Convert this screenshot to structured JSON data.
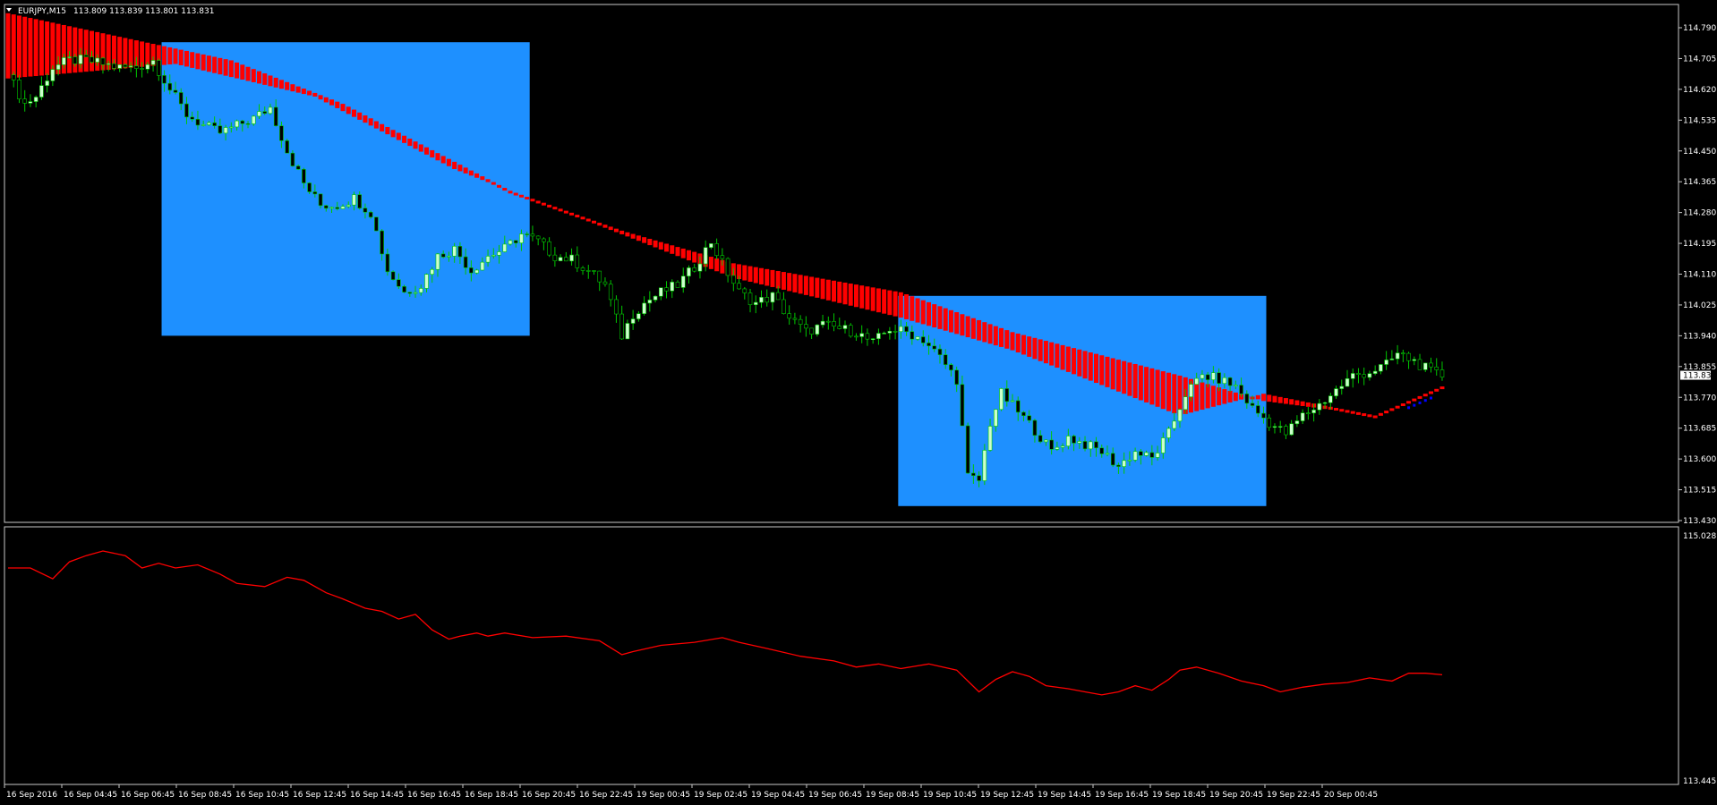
{
  "window": {
    "symbol": "EURJPY,M15",
    "ohlc": "113.809 113.839 113.801 113.831"
  },
  "colors": {
    "background": "#000000",
    "highlight": "#1e90ff",
    "band": "#ff0000",
    "bull_body": "#ccffcc",
    "bear_body": "#000000",
    "wick": "#00c800",
    "indicator": "#ff0000",
    "cursor_dots": "#0000ff"
  },
  "chart_data": [
    {
      "type": "candlestick",
      "title": "EURJPY,M15",
      "y_ticks": [
        "114.790",
        "114.705",
        "114.620",
        "114.535",
        "114.450",
        "114.365",
        "114.280",
        "114.195",
        "114.110",
        "114.025",
        "113.940",
        "113.855",
        "113.770",
        "113.685",
        "113.600",
        "113.515",
        "113.430"
      ],
      "ylim": [
        113.43,
        114.79
      ],
      "x_ticks": [
        "16 Sep 2016",
        "16 Sep 04:45",
        "16 Sep 06:45",
        "16 Sep 08:45",
        "16 Sep 10:45",
        "16 Sep 12:45",
        "16 Sep 14:45",
        "16 Sep 16:45",
        "16 Sep 18:45",
        "16 Sep 20:45",
        "16 Sep 22:45",
        "19 Sep 00:45",
        "19 Sep 02:45",
        "19 Sep 04:45",
        "19 Sep 06:45",
        "19 Sep 08:45",
        "19 Sep 10:45",
        "19 Sep 12:45",
        "19 Sep 14:45",
        "19 Sep 16:45",
        "19 Sep 18:45",
        "19 Sep 20:45",
        "19 Sep 22:45",
        "20 Sep 00:45"
      ],
      "current_price": "113.831",
      "close_path": [
        [
          0,
          114.66
        ],
        [
          3,
          114.58
        ],
        [
          5,
          114.6
        ],
        [
          8,
          114.68
        ],
        [
          11,
          114.7
        ],
        [
          14,
          114.7
        ],
        [
          17,
          114.69
        ],
        [
          20,
          114.68
        ],
        [
          23,
          114.68
        ],
        [
          26,
          114.7
        ],
        [
          29,
          114.62
        ],
        [
          32,
          114.55
        ],
        [
          35,
          114.52
        ],
        [
          38,
          114.5
        ],
        [
          41,
          114.52
        ],
        [
          44,
          114.54
        ],
        [
          47,
          114.57
        ],
        [
          50,
          114.45
        ],
        [
          53,
          114.36
        ],
        [
          56,
          114.3
        ],
        [
          59,
          114.3
        ],
        [
          62,
          114.32
        ],
        [
          65,
          114.28
        ],
        [
          68,
          114.12
        ],
        [
          71,
          114.06
        ],
        [
          74,
          114.08
        ],
        [
          77,
          114.16
        ],
        [
          80,
          114.18
        ],
        [
          83,
          114.12
        ],
        [
          86,
          114.16
        ],
        [
          89,
          114.18
        ],
        [
          92,
          114.22
        ],
        [
          95,
          114.2
        ],
        [
          98,
          114.16
        ],
        [
          101,
          114.15
        ],
        [
          104,
          114.12
        ],
        [
          107,
          114.08
        ],
        [
          110,
          113.94
        ],
        [
          112,
          114.0
        ],
        [
          114,
          114.03
        ],
        [
          117,
          114.06
        ],
        [
          120,
          114.08
        ],
        [
          123,
          114.13
        ],
        [
          126,
          114.2
        ],
        [
          128,
          114.14
        ],
        [
          131,
          114.06
        ],
        [
          134,
          114.03
        ],
        [
          137,
          114.05
        ],
        [
          140,
          113.99
        ],
        [
          143,
          113.95
        ],
        [
          146,
          113.97
        ],
        [
          149,
          113.96
        ],
        [
          152,
          113.95
        ],
        [
          155,
          113.92
        ],
        [
          158,
          113.96
        ],
        [
          161,
          113.95
        ],
        [
          164,
          113.93
        ],
        [
          167,
          113.88
        ],
        [
          170,
          113.82
        ],
        [
          172,
          113.55
        ],
        [
          174,
          113.54
        ],
        [
          176,
          113.7
        ],
        [
          178,
          113.78
        ],
        [
          181,
          113.73
        ],
        [
          184,
          113.68
        ],
        [
          187,
          113.62
        ],
        [
          190,
          113.66
        ],
        [
          193,
          113.64
        ],
        [
          196,
          113.62
        ],
        [
          199,
          113.58
        ],
        [
          202,
          113.62
        ],
        [
          205,
          113.6
        ],
        [
          208,
          113.67
        ],
        [
          211,
          113.78
        ],
        [
          214,
          113.83
        ],
        [
          217,
          113.82
        ],
        [
          220,
          113.8
        ],
        [
          223,
          113.74
        ],
        [
          226,
          113.7
        ],
        [
          229,
          113.67
        ],
        [
          232,
          113.72
        ],
        [
          235,
          113.75
        ],
        [
          238,
          113.79
        ],
        [
          241,
          113.83
        ],
        [
          244,
          113.84
        ],
        [
          247,
          113.86
        ],
        [
          249,
          113.89
        ],
        [
          252,
          113.87
        ],
        [
          255,
          113.84
        ],
        [
          257,
          113.83
        ]
      ],
      "band_top": [
        [
          0,
          114.83
        ],
        [
          40,
          114.7
        ],
        [
          60,
          114.58
        ],
        [
          90,
          114.34
        ],
        [
          110,
          114.23
        ],
        [
          130,
          114.14
        ],
        [
          160,
          114.06
        ],
        [
          180,
          113.95
        ],
        [
          210,
          113.83
        ],
        [
          225,
          113.76
        ],
        [
          245,
          113.72
        ],
        [
          257,
          113.8
        ]
      ],
      "band_bottom": [
        [
          0,
          114.65
        ],
        [
          30,
          114.69
        ],
        [
          55,
          114.6
        ],
        [
          80,
          114.4
        ],
        [
          110,
          114.22
        ],
        [
          130,
          114.1
        ],
        [
          160,
          113.99
        ],
        [
          180,
          113.9
        ],
        [
          210,
          113.72
        ],
        [
          225,
          113.78
        ],
        [
          245,
          113.72
        ],
        [
          257,
          113.8
        ]
      ],
      "highlight_boxes": [
        {
          "from": 28,
          "to": 93,
          "high": 114.75,
          "low": 113.94
        },
        {
          "from": 160,
          "to": 225,
          "high": 114.05,
          "low": 113.47
        }
      ]
    },
    {
      "type": "line",
      "title": "",
      "ylim": [
        113.445,
        115.028
      ],
      "y_ticks": [
        "115.028",
        "113.445"
      ],
      "series": [
        {
          "values_path": [
            [
              0,
              114.82
            ],
            [
              4,
              114.82
            ],
            [
              8,
              114.75
            ],
            [
              11,
              114.86
            ],
            [
              14,
              114.9
            ],
            [
              17,
              114.93
            ],
            [
              21,
              114.9
            ],
            [
              24,
              114.82
            ],
            [
              27,
              114.85
            ],
            [
              30,
              114.82
            ],
            [
              34,
              114.84
            ],
            [
              38,
              114.78
            ],
            [
              41,
              114.72
            ],
            [
              46,
              114.7
            ],
            [
              50,
              114.76
            ],
            [
              53,
              114.74
            ],
            [
              57,
              114.66
            ],
            [
              60,
              114.62
            ],
            [
              64,
              114.56
            ],
            [
              67,
              114.54
            ],
            [
              70,
              114.49
            ],
            [
              73,
              114.52
            ],
            [
              76,
              114.42
            ],
            [
              79,
              114.36
            ],
            [
              81,
              114.38
            ],
            [
              84,
              114.4
            ],
            [
              86,
              114.38
            ],
            [
              89,
              114.4
            ],
            [
              94,
              114.37
            ],
            [
              100,
              114.38
            ],
            [
              106,
              114.35
            ],
            [
              110,
              114.26
            ],
            [
              112,
              114.28
            ],
            [
              117,
              114.32
            ],
            [
              123,
              114.34
            ],
            [
              128,
              114.37
            ],
            [
              131,
              114.34
            ],
            [
              136,
              114.3
            ],
            [
              142,
              114.25
            ],
            [
              148,
              114.22
            ],
            [
              152,
              114.18
            ],
            [
              156,
              114.2
            ],
            [
              160,
              114.17
            ],
            [
              165,
              114.2
            ],
            [
              170,
              114.16
            ],
            [
              174,
              114.02
            ],
            [
              177,
              114.1
            ],
            [
              180,
              114.15
            ],
            [
              183,
              114.12
            ],
            [
              186,
              114.06
            ],
            [
              190,
              114.04
            ],
            [
              193,
              114.02
            ],
            [
              196,
              114.0
            ],
            [
              199,
              114.02
            ],
            [
              202,
              114.06
            ],
            [
              205,
              114.03
            ],
            [
              208,
              114.1
            ],
            [
              210,
              114.16
            ],
            [
              213,
              114.18
            ],
            [
              217,
              114.14
            ],
            [
              221,
              114.09
            ],
            [
              225,
              114.06
            ],
            [
              228,
              114.02
            ],
            [
              232,
              114.05
            ],
            [
              236,
              114.07
            ],
            [
              240,
              114.08
            ],
            [
              244,
              114.11
            ],
            [
              248,
              114.09
            ],
            [
              251,
              114.14
            ],
            [
              254,
              114.14
            ],
            [
              257,
              114.13
            ]
          ]
        }
      ]
    }
  ]
}
